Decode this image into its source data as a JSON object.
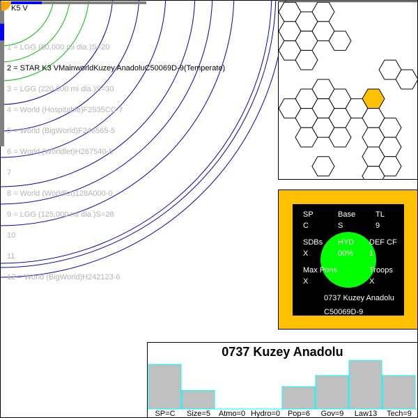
{
  "star": {
    "label": "K5 V",
    "color": "#ffa500"
  },
  "orbits": [
    {
      "label": "1 = LGG (80,000 mi dia.)S=20",
      "color": "#00c000",
      "selected": false
    },
    {
      "label": "2 = STAR K3 VMainworldKuzey AnadoluC50069D-9(Temperate)",
      "color": "#00c000",
      "selected": true
    },
    {
      "label": "3 = LGG (220,000 mi dia.)S=30",
      "color": "#00c000",
      "selected": false
    },
    {
      "label": "4 = World  (Hospitable)F2535CC-7",
      "color": "#0000b0",
      "selected": false
    },
    {
      "label": "5 = World  (BigWorld)F246565-5",
      "color": "#0000b0",
      "selected": false
    },
    {
      "label": "6 = World  (Worldlet)H267540-5",
      "color": "#0000b0",
      "selected": false
    },
    {
      "label": "7",
      "color": "#0000b0",
      "selected": false
    },
    {
      "label": "8 = World  (Worldlet)128A000-0",
      "color": "#0000b0",
      "selected": false
    },
    {
      "label": "9 = LGG (125,000 mi dia.)S=28",
      "color": "#0000b0",
      "selected": false
    },
    {
      "label": "10",
      "color": "#0000b0",
      "selected": false
    },
    {
      "label": "11",
      "color": "#0000b0",
      "selected": false
    },
    {
      "label": "12 = World  (BigWorld)H242123-6",
      "color": "#0000b0",
      "selected": false
    }
  ],
  "hexmap": {
    "highlight_color": "#ffc000",
    "line_color": "#000000"
  },
  "info": {
    "sp_label": "SP",
    "sp_value": "C",
    "base_label": "Base",
    "base_value": "S",
    "tl_label": "TL",
    "tl_value": "9",
    "sdb_label": "SDBs",
    "sdb_value": "X",
    "hyd_label": "HYD",
    "hyd_value": "00%",
    "def_label": "DEF CF",
    "def_value": "1",
    "maxpons_label": "Max Pons",
    "maxpons_value": "X",
    "troops_label": "Troops",
    "troops_value": "X",
    "name": "0737 Kuzey Anadolu",
    "uwp": "C50069D-9",
    "panel_color": "#ffc000",
    "hyd_color": "#00ff00"
  },
  "stats": {
    "title": "0737 Kuzey Anadolu",
    "bar_color": "#c0c0c0",
    "bar_edge": "#00ffff",
    "bars": [
      {
        "label": "SP=C",
        "value": 12
      },
      {
        "label": "Size=5",
        "value": 5
      },
      {
        "label": "Atmo=0",
        "value": 0
      },
      {
        "label": "Hydro=0",
        "value": 0
      },
      {
        "label": "Pop=6",
        "value": 6
      },
      {
        "label": "Gov=9",
        "value": 9
      },
      {
        "label": "Law13",
        "value": 13
      },
      {
        "label": "Tech=9",
        "value": 9
      }
    ]
  }
}
